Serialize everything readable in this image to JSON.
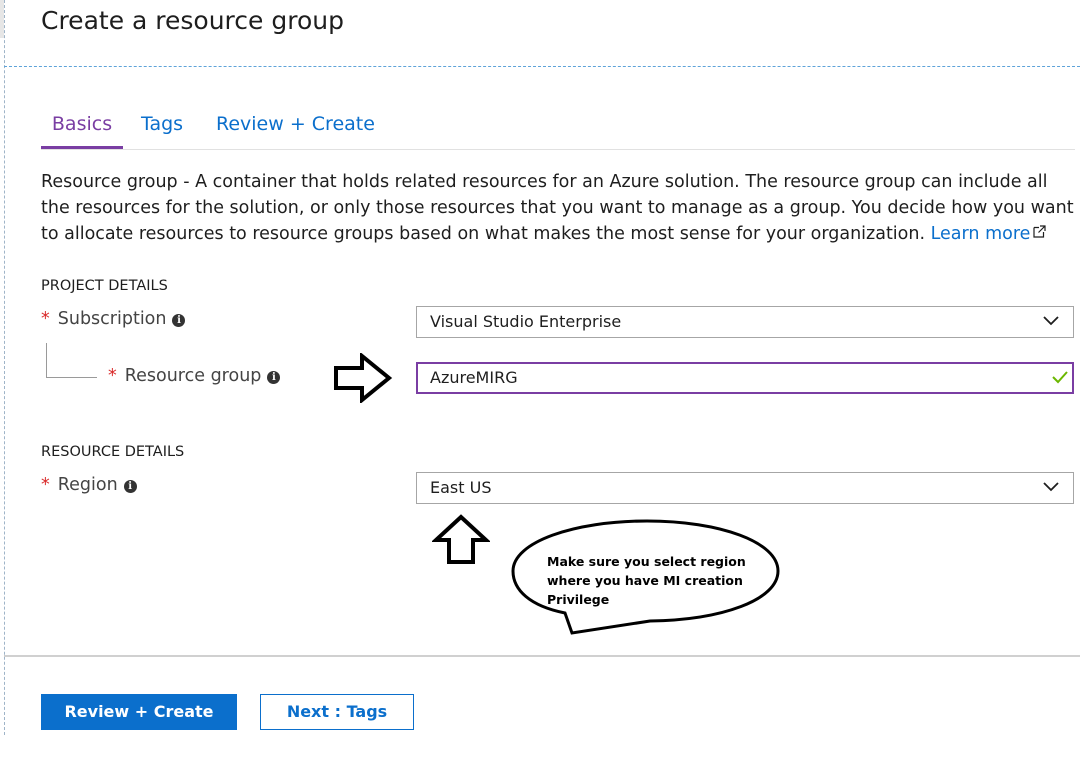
{
  "page": {
    "title": "Create a resource group"
  },
  "tabs": [
    {
      "label": "Basics",
      "active": true
    },
    {
      "label": "Tags",
      "active": false
    },
    {
      "label": "Review + Create",
      "active": false
    }
  ],
  "description": {
    "term": "Resource group",
    "text": " - A container that holds related resources for an Azure solution. The resource group can include all the resources for the solution, or only those resources that you want to manage as a group. You decide how you want to allocate resources to resource groups based on what makes the most sense for your organization. ",
    "link_label": "Learn more"
  },
  "project_details": {
    "heading": "PROJECT DETAILS",
    "subscription": {
      "label": "Subscription",
      "value": "Visual Studio Enterprise"
    },
    "resource_group": {
      "label": "Resource group",
      "value": "AzureMIRG"
    }
  },
  "resource_details": {
    "heading": "RESOURCE DETAILS",
    "region": {
      "label": "Region",
      "value": "East US"
    }
  },
  "required_marker": "*",
  "info_glyph": "i",
  "annotation": {
    "callout_text": "Make sure you select region where you have MI creation Privilege"
  },
  "footer": {
    "review_create_label": "Review + Create",
    "next_label": "Next : Tags"
  },
  "colors": {
    "accent_purple": "#7a3ea3",
    "link_blue": "#0b6fcc",
    "required_red": "#d92a2a",
    "valid_green": "#6bb700"
  }
}
